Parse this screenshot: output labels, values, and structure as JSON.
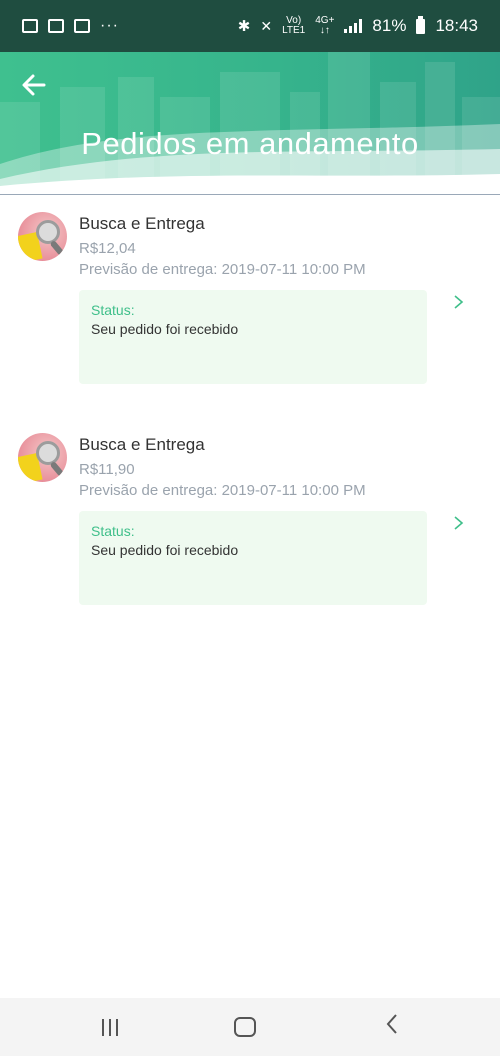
{
  "status_bar": {
    "network_top": "Vo)",
    "network_bottom": "LTE1",
    "gen_top": "4G+",
    "gen_bottom": "↓↑",
    "battery": "81%",
    "time": "18:43",
    "more": "···"
  },
  "header": {
    "back_icon": "arrow-left-icon",
    "title": "Pedidos em andamento"
  },
  "orders": [
    {
      "title": "Busca e Entrega",
      "price": "R$12,04",
      "forecast": "Previsão de entrega: 2019-07-11 10:00 PM",
      "status_label": "Status:",
      "status_text": "Seu pedido foi recebido"
    },
    {
      "title": "Busca e Entrega",
      "price": "R$11,90",
      "forecast": "Previsão de entrega: 2019-07-11 10:00 PM",
      "status_label": "Status:",
      "status_text": "Seu pedido foi recebido"
    }
  ],
  "colors": {
    "status_bar": "#1f4d40",
    "header": "#3fc08f",
    "accent": "#3fbf8a",
    "status_box": "#effaf0"
  }
}
